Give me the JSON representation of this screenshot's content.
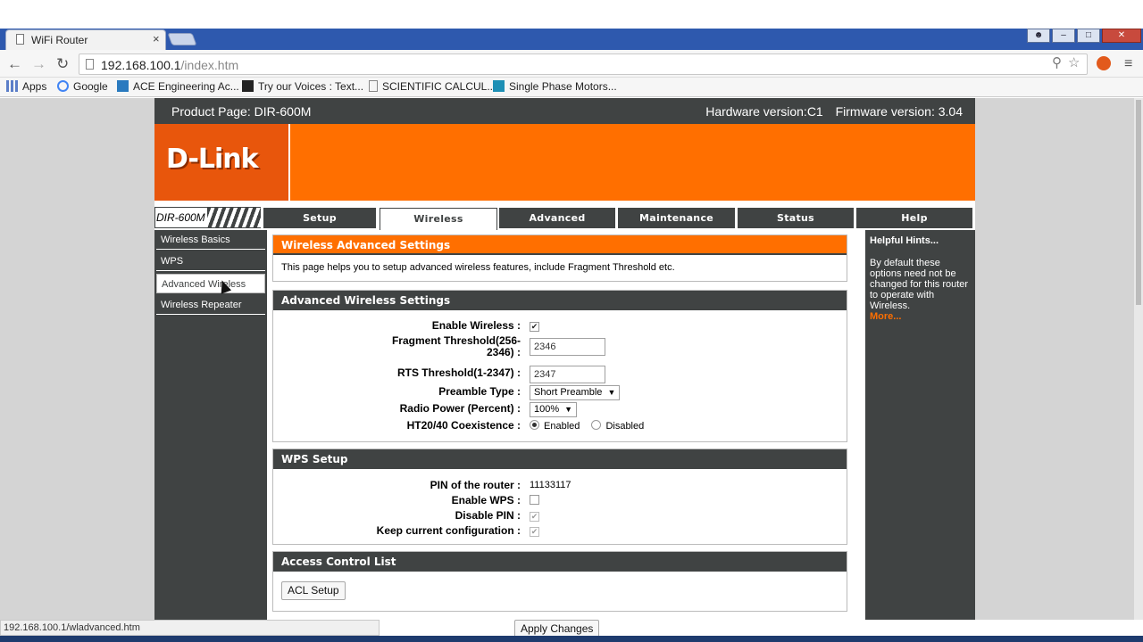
{
  "browser": {
    "tab_title": "WiFi Router",
    "tab_close": "×",
    "url_host": "192.168.100.1",
    "url_path": "/index.htm",
    "status_url": "192.168.100.1/wladvanced.htm",
    "bookmarks": [
      {
        "label": "Apps",
        "icon": "apps-grid-icon"
      },
      {
        "label": "Google",
        "icon": "google-icon"
      },
      {
        "label": "ACE Engineering Ac...",
        "icon": "ace-icon"
      },
      {
        "label": "Try our Voices : Text...",
        "icon": "voices-icon"
      },
      {
        "label": "SCIENTIFIC CALCUL...",
        "icon": "page-icon"
      },
      {
        "label": "Single Phase Motors...",
        "icon": "eq-icon"
      }
    ]
  },
  "router": {
    "product": "Product Page: DIR-600M",
    "hardware": "Hardware version:C1",
    "firmware": "Firmware version: 3.04",
    "logo": "D-Link",
    "model": "DIR-600M",
    "tabs": [
      {
        "label": "Setup"
      },
      {
        "label": "Wireless",
        "active": true
      },
      {
        "label": "Advanced"
      },
      {
        "label": "Maintenance"
      },
      {
        "label": "Status"
      },
      {
        "label": "Help"
      }
    ],
    "sidebar": [
      {
        "label": "Wireless Basics"
      },
      {
        "label": "WPS"
      },
      {
        "label": "Advanced Wireless",
        "active": true
      },
      {
        "label": "Wireless Repeater"
      }
    ]
  },
  "intro": {
    "title": "Wireless Advanced Settings",
    "text": "This page helps you to setup advanced wireless features, include Fragment Threshold etc."
  },
  "advanced": {
    "title": "Advanced Wireless Settings",
    "enable_wireless_label": "Enable Wireless :",
    "enable_wireless": true,
    "fragment_label_1": "Fragment Threshold(256-",
    "fragment_label_2": "2346) :",
    "fragment_value": "2346",
    "rts_label": "RTS Threshold(1-2347) :",
    "rts_value": "2347",
    "preamble_label": "Preamble Type :",
    "preamble_value": "Short Preamble",
    "radio_power_label": "Radio Power (Percent) :",
    "radio_power_value": "100%",
    "coexist_label": "HT20/40 Coexistence :",
    "coexist_enabled": "Enabled",
    "coexist_disabled": "Disabled"
  },
  "wps": {
    "title": "WPS Setup",
    "pin_label": "PIN of the router :",
    "pin_value": "11133117",
    "enable_label": "Enable WPS :",
    "disable_pin_label": "Disable PIN :",
    "keep_label": "Keep current configuration :"
  },
  "acl": {
    "title": "Access Control List",
    "button": "ACL Setup"
  },
  "apply_button": "Apply Changes",
  "hints": {
    "title": "Helpful Hints...",
    "body": "By default these options need not be changed for this router to operate with Wireless.",
    "more": "More..."
  },
  "colors": {
    "dlink_orange": "#ff6f00",
    "dlink_dark": "#404343",
    "chrome_blue": "#2e59ae"
  }
}
